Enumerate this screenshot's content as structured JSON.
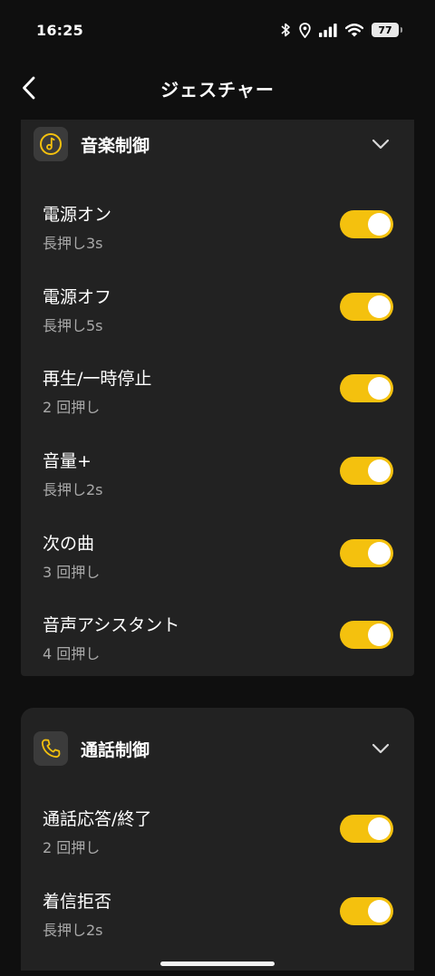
{
  "status_bar": {
    "time": "16:25",
    "icons": [
      "bluetooth-icon",
      "location-icon",
      "signal-icon",
      "wifi-icon"
    ],
    "battery": "77"
  },
  "header": {
    "title": "ジェスチャー",
    "back_icon": "chevron-left-icon"
  },
  "colors": {
    "accent": "#f4c10e",
    "background": "#0f0f0f",
    "card": "#222222",
    "subtext": "#a9a9a9"
  },
  "music_section": {
    "title": "音楽制御",
    "icon": "music-note-icon",
    "expanded": true,
    "items": [
      {
        "label": "電源オン",
        "sub": "長押し3s",
        "enabled": true
      },
      {
        "label": "電源オフ",
        "sub": "長押し5s",
        "enabled": true
      },
      {
        "label": "再生/一時停止",
        "sub": " 2 回押し",
        "enabled": true
      },
      {
        "label": "音量+",
        "sub": "長押し2s",
        "enabled": true
      },
      {
        "label": "次の曲",
        "sub": " 3 回押し",
        "enabled": true
      },
      {
        "label": "音声アシスタント",
        "sub": "4 回押し",
        "enabled": true
      }
    ]
  },
  "call_section": {
    "title": "通話制御",
    "icon": "phone-icon",
    "expanded": true,
    "items": [
      {
        "label": "通話応答/終了",
        "sub": " 2 回押し",
        "enabled": true
      },
      {
        "label": "着信拒否",
        "sub": "長押し2s",
        "enabled": true
      }
    ]
  }
}
